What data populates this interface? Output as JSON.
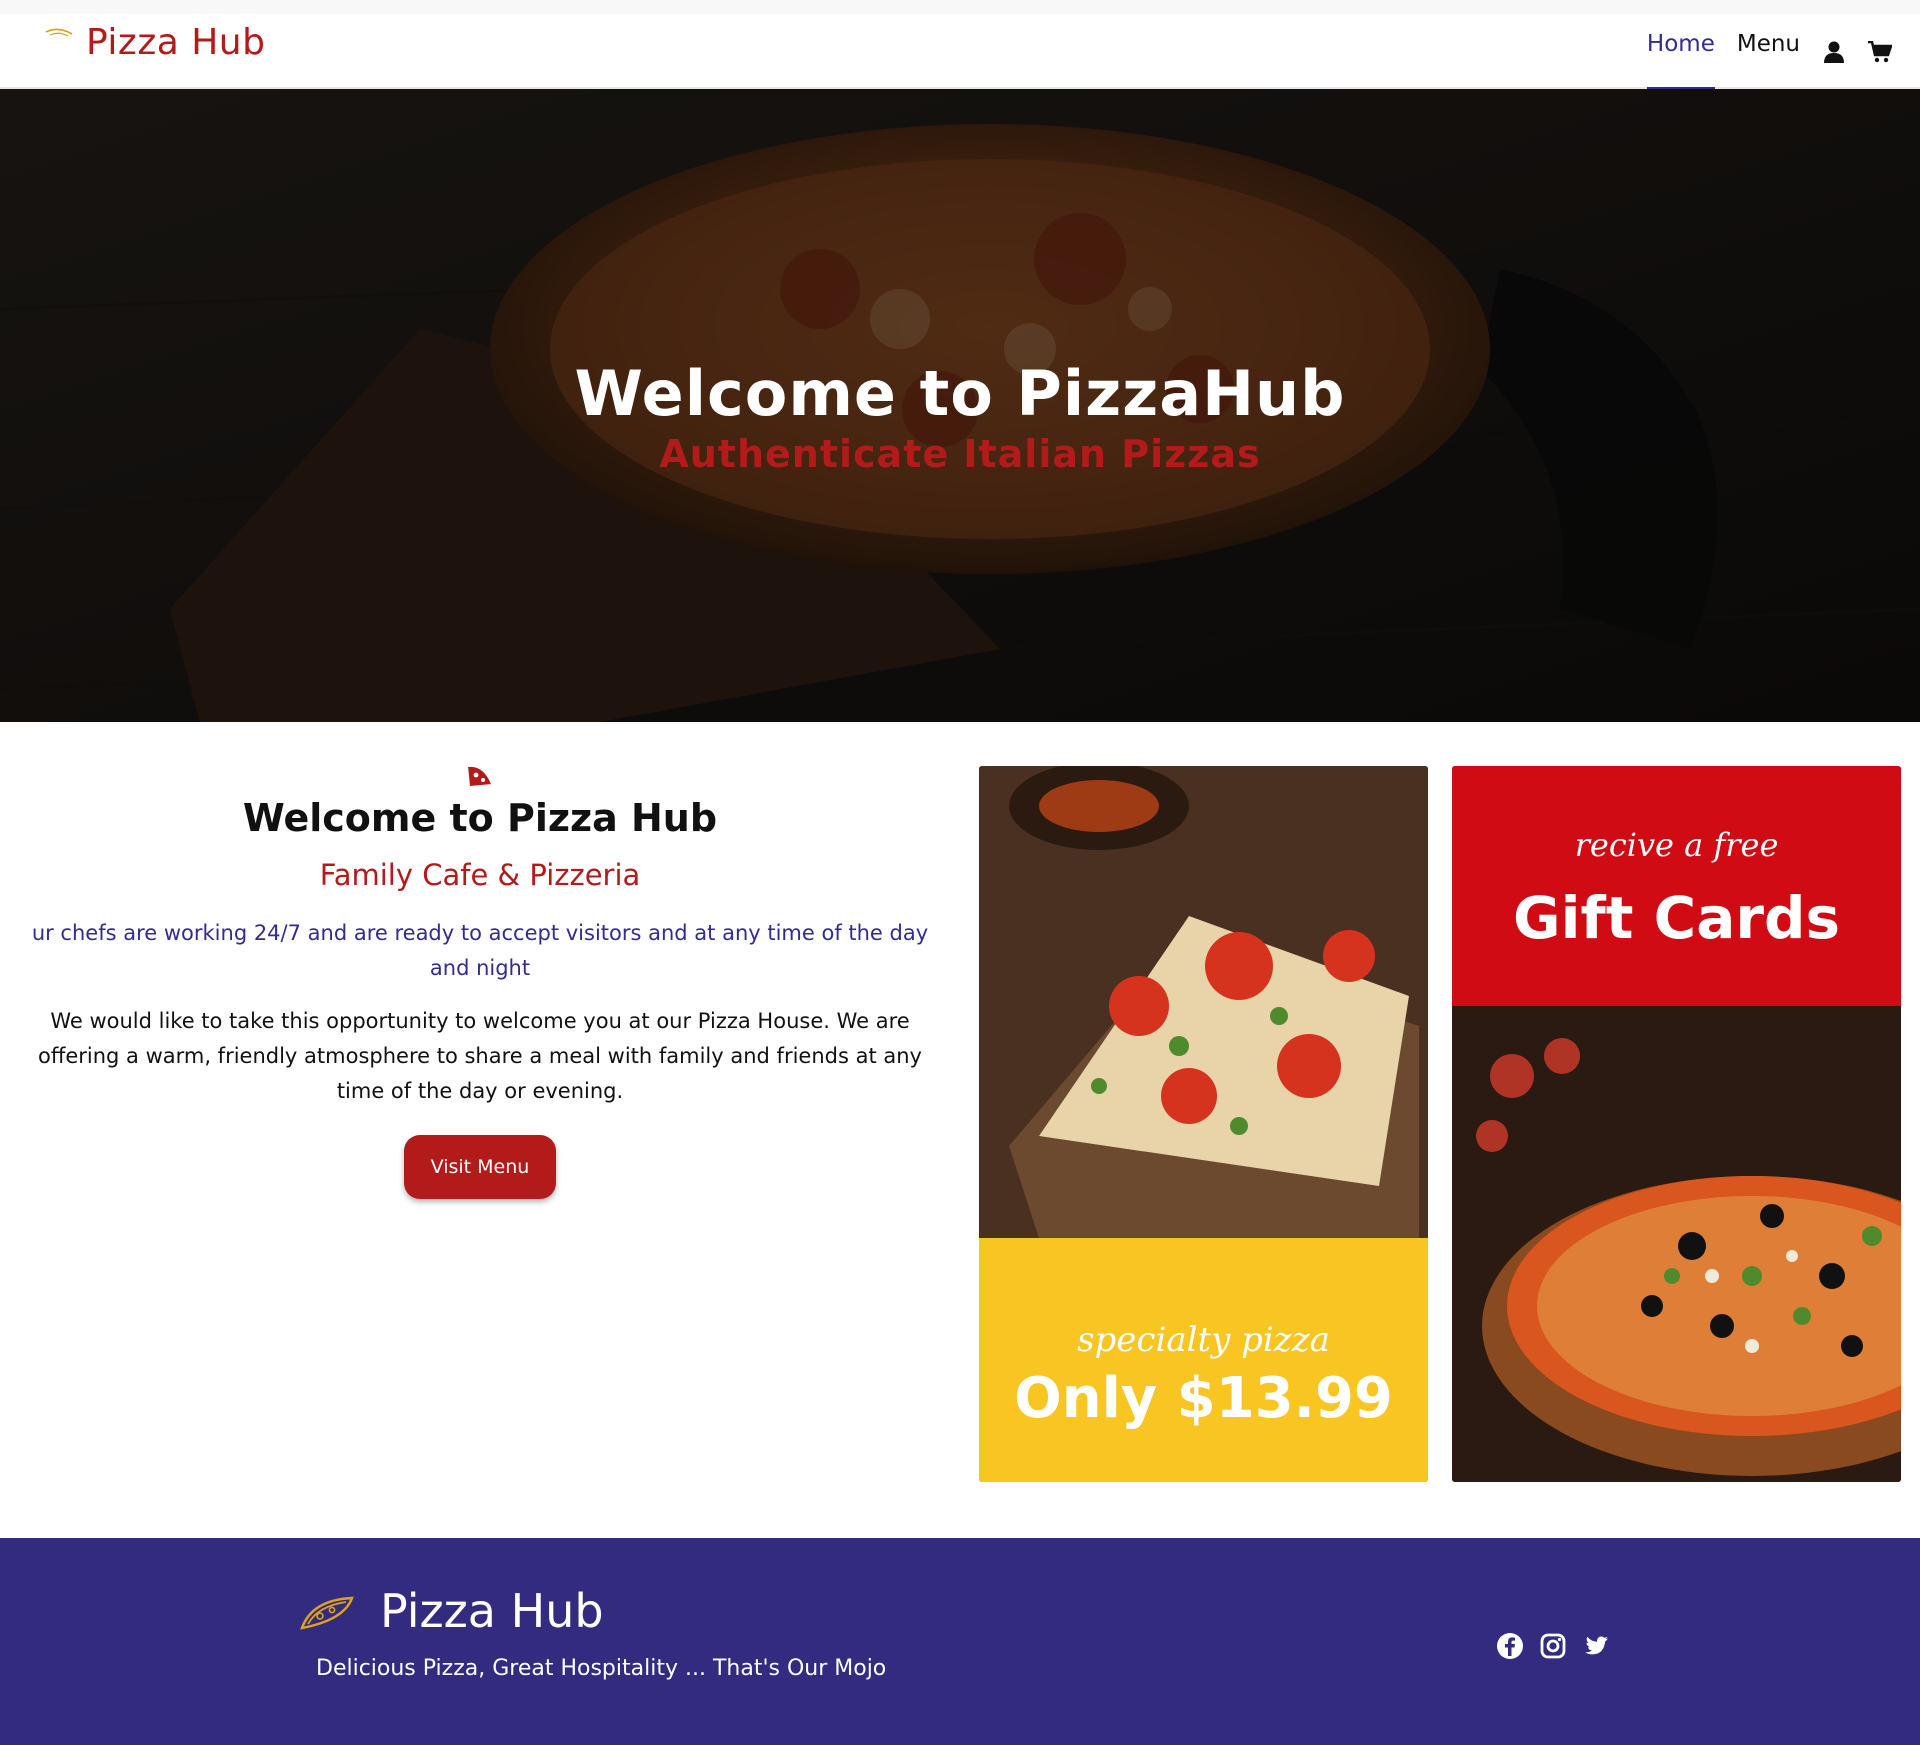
{
  "navbar": {
    "brand": "Pizza Hub",
    "links": [
      {
        "label": "Home",
        "active": true
      },
      {
        "label": "Menu",
        "active": false
      }
    ],
    "icons": [
      "user-icon",
      "cart-icon"
    ]
  },
  "hero": {
    "title": "Welcome to PizzaHub",
    "subtitle": "Authenticate Italian Pizzas"
  },
  "welcome": {
    "icon": "pizza-slice-icon",
    "title": "Welcome to Pizza Hub",
    "subtitle": "Family Cafe & Pizzeria",
    "chefs_text": "ur chefs are working 24/7 and are ready to accept visitors and at any time of the day and night",
    "body": "We would like to take this opportunity to welcome you at our Pizza House. We are offering a warm, friendly atmosphere to share a meal with family and friends at any time of the day or evening.",
    "button": "Visit Menu"
  },
  "promos": {
    "specialty": {
      "script": "specialty pizza",
      "price": "Only $13.99"
    },
    "gift": {
      "script": "recive a free",
      "title": "Gift Cards"
    }
  },
  "footer": {
    "brand": "Pizza Hub",
    "tagline": "Delicious Pizza, Great Hospitality ... That's Our Mojo",
    "social": [
      "facebook-icon",
      "instagram-icon",
      "twitter-icon"
    ]
  },
  "colors": {
    "brand_red": "#b31b1b",
    "nav_active": "#332b8f",
    "footer_bg": "#332b80",
    "promo_yellow": "#f8c523",
    "gift_red": "#d10b14"
  }
}
